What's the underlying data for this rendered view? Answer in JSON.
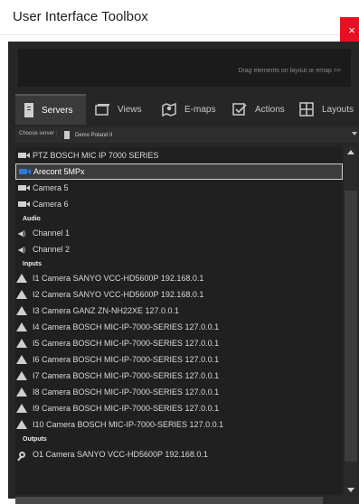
{
  "window": {
    "title": "User Interface Toolbox",
    "close_glyph": "×",
    "close_color": "#e81123"
  },
  "dropzone": {
    "hint": "Drag elements on layout or emap >>"
  },
  "tabs": [
    {
      "label": "Servers",
      "icon": "server-icon"
    },
    {
      "label": "Views",
      "icon": "views-icon"
    },
    {
      "label": "E-maps",
      "icon": "map-icon"
    },
    {
      "label": "Actions",
      "icon": "actions-icon"
    },
    {
      "label": "Layouts",
      "icon": "layouts-icon"
    }
  ],
  "server_select": {
    "label": "Choose server :",
    "value": "Demo Poland II"
  },
  "cameras": [
    "PTZ BOSCH MIC IP 7000 SERIES",
    "Arecont 5MPx",
    "Camera 5",
    "Camera 6"
  ],
  "audio": {
    "header": "Audio",
    "items": [
      "Channel 1",
      "Channel 2"
    ]
  },
  "inputs": {
    "header": "Inputs",
    "items": [
      "I1 Camera SANYO VCC-HD5600P 192.168.0.1",
      "I2 Camera SANYO VCC-HD5600P 192.168.0.1",
      "I3 Camera GANZ ZN-NH22XE 127.0.0.1",
      "I4 Camera BOSCH MIC-IP-7000-SERIES 127.0.0.1",
      "I5 Camera BOSCH MIC-IP-7000-SERIES 127.0.0.1",
      "I6 Camera BOSCH MIC-IP-7000-SERIES 127.0.0.1",
      "I7 Camera BOSCH MIC-IP-7000-SERIES 127.0.0.1",
      "I8 Camera BOSCH MIC-IP-7000-SERIES 127.0.0.1",
      "I9 Camera BOSCH MIC-IP-7000-SERIES 127.0.0.1",
      "I10 Camera BOSCH MIC-IP-7000-SERIES 127.0.0.1"
    ]
  },
  "outputs": {
    "header": "Outputs",
    "items": [
      "O1 Camera SANYO VCC-HD5600P 192.168.0.1"
    ]
  },
  "colors": {
    "panel_bg": "#262626",
    "selected_camera_icon": "#2e7bd6"
  }
}
